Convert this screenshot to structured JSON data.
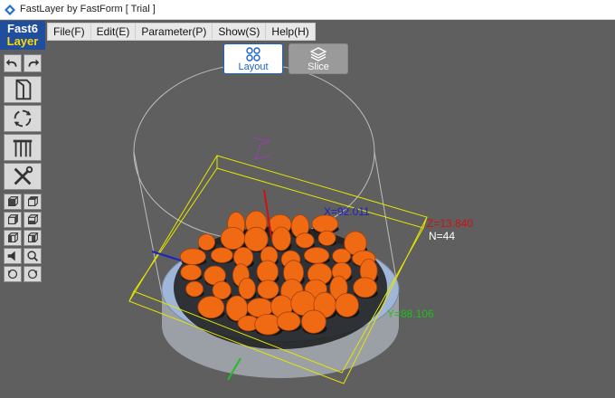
{
  "window": {
    "title": "FastLayer by FastForm [ Trial ]"
  },
  "logo": {
    "line1": "Fast6",
    "line2": "Layer"
  },
  "menu": {
    "items": [
      {
        "label": "File(F)"
      },
      {
        "label": "Edit(E)"
      },
      {
        "label": "Parameter(P)"
      },
      {
        "label": "Show(S)"
      },
      {
        "label": "Help(H)"
      }
    ]
  },
  "mode_tabs": {
    "layout_label": "Layout",
    "slice_label": "Slice"
  },
  "viewport": {
    "x_readout": "X=92.011",
    "y_readout": "Y=88.106",
    "z_readout": "Z=13.840",
    "count_readout": "N=44"
  },
  "colors": {
    "part": "#f06a14",
    "bbox": "#e6e600",
    "x_readout": "#2020c0",
    "y_readout": "#1fbf1f",
    "z_readout": "#d01010",
    "count_readout": "#ffffff",
    "platform": "#9fb6d8"
  },
  "icons": {
    "app": "fastlayer-app-icon",
    "undo": "undo-arrow-icon",
    "redo": "redo-arrow-icon",
    "import": "import-file-icon",
    "rotate": "auto-rotate-icon",
    "support": "support-structure-icon",
    "tools": "wrench-screwdriver-icon",
    "layout": "layout-arrange-icon",
    "slice": "layers-stack-icon"
  }
}
